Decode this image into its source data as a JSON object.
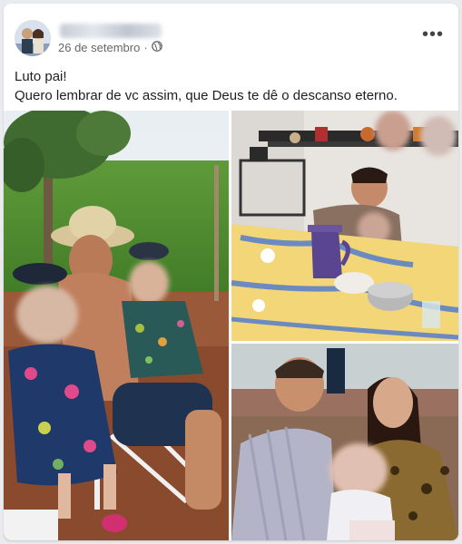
{
  "post": {
    "date": "26 de setembro",
    "separator": "·",
    "audience_icon": "globe-icon",
    "more_icon": "more-options-icon",
    "more_label": "•••",
    "text_lines": [
      "Luto pai!",
      "Quero lembrar de vc assim, que Deus te dê o descanso eterno."
    ]
  },
  "photos": [
    {
      "subject": "photo-left-family-outdoors"
    },
    {
      "subject": "photo-top-right-kitchen"
    },
    {
      "subject": "photo-bottom-right-couple-with-child"
    }
  ],
  "colors": {
    "card_background": "#ffffff",
    "page_background": "#e9ebee",
    "secondary_text": "#65676b",
    "primary_text": "#1c1e21"
  }
}
